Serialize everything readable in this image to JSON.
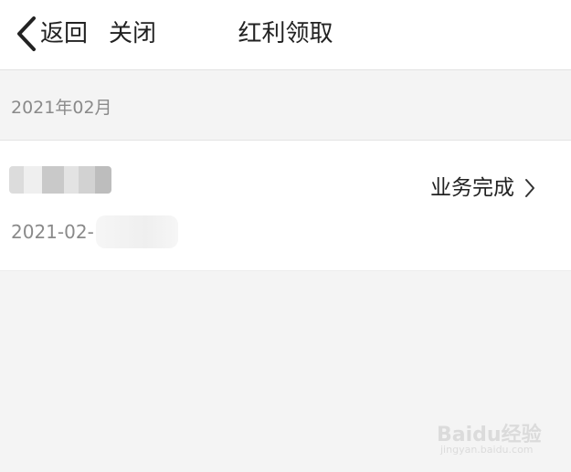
{
  "header": {
    "back_label": "返回",
    "close_label": "关闭",
    "title": "红利领取"
  },
  "month_group": {
    "label": "2021年02月"
  },
  "record": {
    "date_prefix": "2021-02-",
    "status_label": "业务完成"
  },
  "watermark": {
    "brand": "Baidu经验",
    "url": "jingyan.baidu.com"
  },
  "icons": {
    "back": "chevron-left-icon",
    "detail": "chevron-right-icon"
  },
  "colors": {
    "background": "#f4f4f4",
    "card": "#ffffff",
    "text_primary": "#222222",
    "text_secondary": "#8a8a8a"
  }
}
